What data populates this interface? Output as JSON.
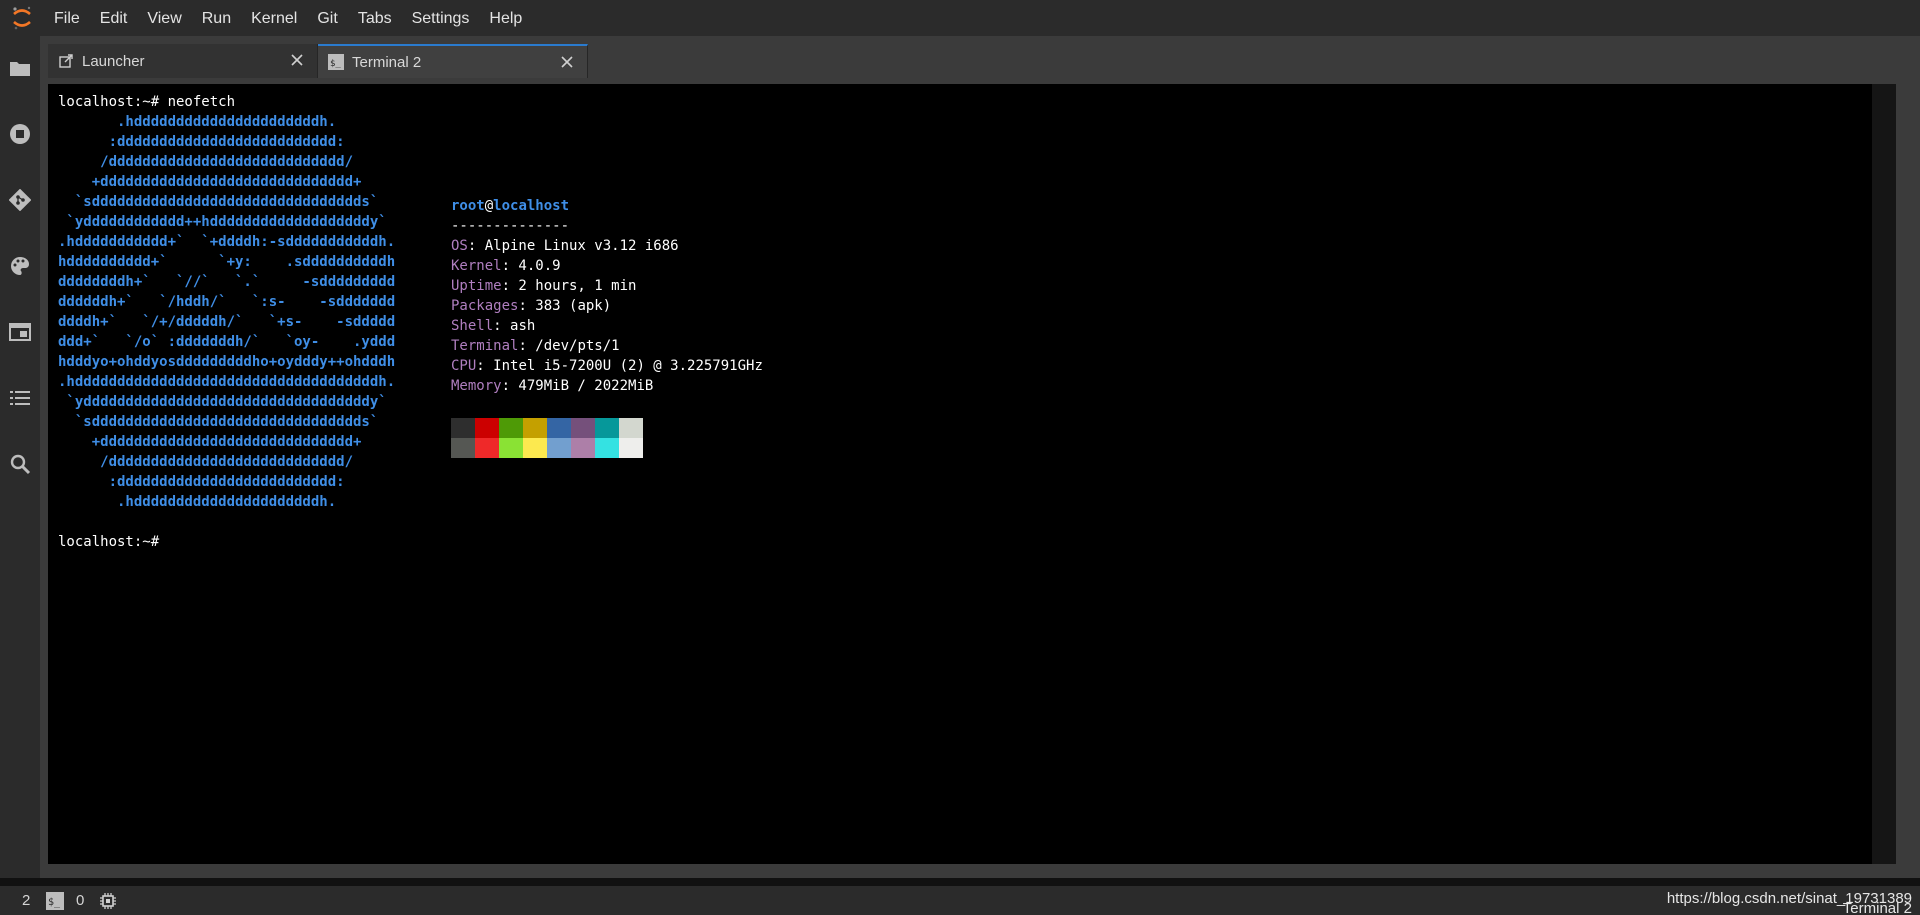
{
  "menubar": {
    "logo_icon": "jupyter-logo-icon",
    "items": [
      "File",
      "Edit",
      "View",
      "Run",
      "Kernel",
      "Git",
      "Tabs",
      "Settings",
      "Help"
    ]
  },
  "sidebar": {
    "icons": [
      "folder-icon",
      "running-stop-icon",
      "git-icon",
      "palette-icon",
      "tabs-icon",
      "list-icon",
      "search-icon"
    ]
  },
  "tabs": [
    {
      "label": "Launcher",
      "icon": "launcher-icon",
      "active": false
    },
    {
      "label": "Terminal 2",
      "icon": "terminal-icon",
      "active": true
    }
  ],
  "terminal": {
    "command_line": "localhost:~# neofetch",
    "logo_lines": [
      "       .hddddddddddddddddddddddh.",
      "      :dddddddddddddddddddddddddd:",
      "     /dddddddddddddddddddddddddddd/",
      "    +dddddddddddddddddddddddddddddd+",
      "  `sdddddddddddddddddddddddddddddddds`",
      " `ydddddddddddd++hdddddddddddddddddddy`",
      ".hddddddddddd+`  `+ddddh:-sdddddddddddh.",
      "hdddddddddd+`      `+y:    .sddddddddddh",
      "ddddddddh+`   `//`   `.`     -sddddddddd",
      "ddddddh+`   `/hddh/`   `:s-    -sddddddd",
      "ddddh+`   `/+/dddddh/`   `+s-    -sddddd",
      "ddd+`   `/o` :dddddddh/`   `oy-    .yddd",
      "hdddyo+ohddyosdddddddddho+oydddy++ohdddh",
      ".hddddddddddddddddddddddddddddddddddddh.",
      " `yddddddddddddddddddddddddddddddddddy`",
      "  `sdddddddddddddddddddddddddddddddds`",
      "    +dddddddddddddddddddddddddddddd+",
      "     /dddddddddddddddddddddddddddd/",
      "      :dddddddddddddddddddddddddd:",
      "       .hddddddddddddddddddddddh."
    ],
    "user": "root",
    "at": "@",
    "host": "localhost",
    "separator": "--------------",
    "info": [
      {
        "key": "OS",
        "value": ": Alpine Linux v3.12 i686"
      },
      {
        "key": "Kernel",
        "value": ": 4.0.9"
      },
      {
        "key": "Uptime",
        "value": ": 2 hours, 1 min"
      },
      {
        "key": "Packages",
        "value": ": 383 (apk)"
      },
      {
        "key": "Shell",
        "value": ": ash"
      },
      {
        "key": "Terminal",
        "value": ": /dev/pts/1"
      },
      {
        "key": "CPU",
        "value": ": Intel i5-7200U (2) @ 3.225791GHz"
      },
      {
        "key": "Memory",
        "value": ": 479MiB / 2022MiB"
      }
    ],
    "palette_row1": [
      "#2e2e2e",
      "#cc0000",
      "#4e9a06",
      "#c4a000",
      "#3465a4",
      "#75507b",
      "#06989a",
      "#d3d7cf"
    ],
    "palette_row2": [
      "#555753",
      "#ef2929",
      "#8ae234",
      "#fce94f",
      "#729fcf",
      "#ad7fa8",
      "#34e2e2",
      "#eeeeec"
    ],
    "prompt": "localhost:~#"
  },
  "statusbar": {
    "terminals_count": "2",
    "kernels_count": "0",
    "watermark": "https://blog.csdn.net/sinat_19731389",
    "current_activity": "Terminal 2"
  },
  "colors": {
    "accent": "#2a7bcf",
    "logo_blue": "#3f8ee6",
    "key_magenta": "#b07fc0",
    "jupyter_orange": "#f37726"
  }
}
